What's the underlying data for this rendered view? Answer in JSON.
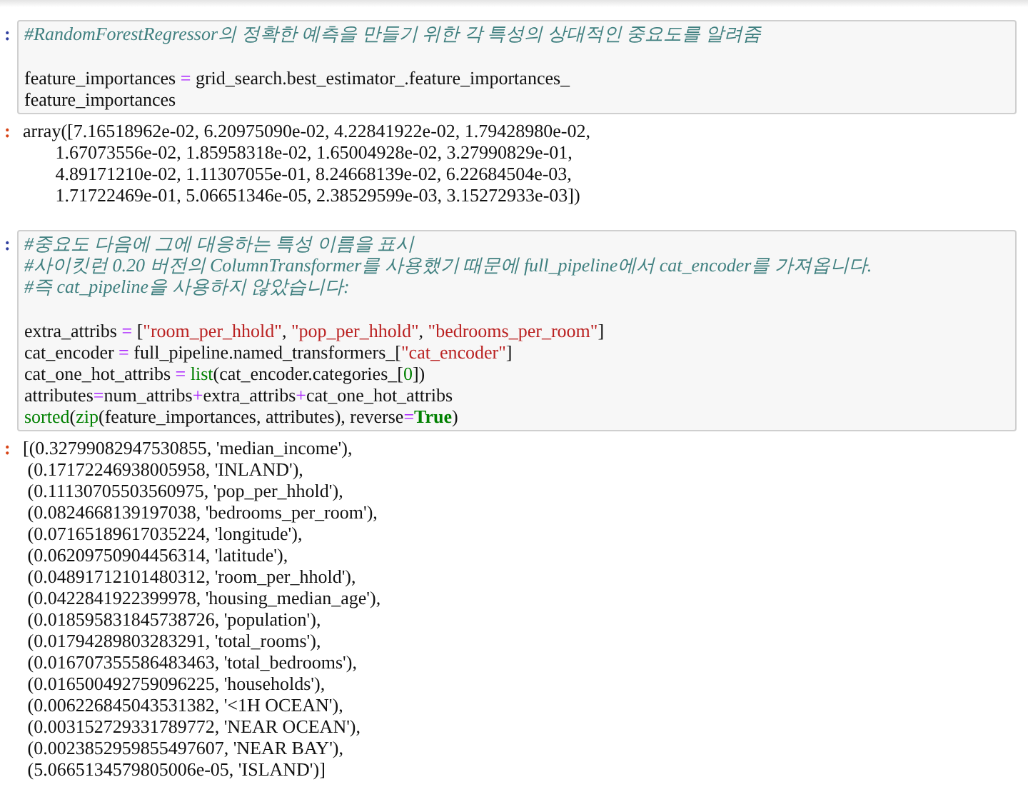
{
  "cells": [
    {
      "kind": "code",
      "prompt": ":",
      "blocks": [
        [
          [
            {
              "kind": "comment",
              "text": "#RandomForestRegressor의 정확한 예측을 만들기 위한 각 특성의 상대적인 중요도를 알려줌"
            }
          ]
        ],
        [
          [
            {
              "kind": "name",
              "text": "feature_importances "
            },
            {
              "kind": "op",
              "text": "="
            },
            {
              "kind": "name",
              "text": " grid_search.best_estimator_.feature_importances_"
            }
          ],
          [
            {
              "kind": "name",
              "text": "feature_importances"
            }
          ]
        ]
      ]
    },
    {
      "kind": "output",
      "prompt": ":",
      "lines": [
        "array([7.16518962e-02, 6.20975090e-02, 4.22841922e-02, 1.79428980e-02,",
        "       1.67073556e-02, 1.85958318e-02, 1.65004928e-02, 3.27990829e-01,",
        "       4.89171210e-02, 1.11307055e-01, 8.24668139e-02, 6.22684504e-03,",
        "       1.71722469e-01, 5.06651346e-05, 2.38529599e-03, 3.15272933e-03])"
      ]
    },
    {
      "kind": "code",
      "prompt": ":",
      "blocks": [
        [
          [
            {
              "kind": "comment",
              "text": "#중요도 다음에 그에 대응하는 특성 이름을 표시"
            }
          ],
          [
            {
              "kind": "comment",
              "text": "#사이킷런 0.20 버전의 ColumnTransformer를 사용했기 때문에 full_pipeline에서 cat_encoder를 가져옵니다."
            }
          ],
          [
            {
              "kind": "comment",
              "text": "#즉 cat_pipeline을 사용하지 않았습니다:"
            }
          ]
        ],
        [
          [
            {
              "kind": "name",
              "text": "extra_attribs "
            },
            {
              "kind": "op",
              "text": "="
            },
            {
              "kind": "name",
              "text": " ["
            },
            {
              "kind": "string",
              "text": "\"room_per_hhold\""
            },
            {
              "kind": "name",
              "text": ", "
            },
            {
              "kind": "string",
              "text": "\"pop_per_hhold\""
            },
            {
              "kind": "name",
              "text": ", "
            },
            {
              "kind": "string",
              "text": "\"bedrooms_per_room\""
            },
            {
              "kind": "name",
              "text": "]"
            }
          ],
          [
            {
              "kind": "name",
              "text": "cat_encoder "
            },
            {
              "kind": "op",
              "text": "="
            },
            {
              "kind": "name",
              "text": " full_pipeline.named_transformers_["
            },
            {
              "kind": "string",
              "text": "\"cat_encoder\""
            },
            {
              "kind": "name",
              "text": "]"
            }
          ],
          [
            {
              "kind": "name",
              "text": "cat_one_hot_attribs "
            },
            {
              "kind": "op",
              "text": "= "
            },
            {
              "kind": "builtin",
              "text": "list"
            },
            {
              "kind": "name",
              "text": "(cat_encoder.categories_["
            },
            {
              "kind": "number",
              "text": "0"
            },
            {
              "kind": "name",
              "text": "])"
            }
          ],
          [
            {
              "kind": "name",
              "text": "attributes"
            },
            {
              "kind": "op",
              "text": "="
            },
            {
              "kind": "name",
              "text": "num_attribs"
            },
            {
              "kind": "op",
              "text": "+"
            },
            {
              "kind": "name",
              "text": "extra_attribs"
            },
            {
              "kind": "op",
              "text": "+"
            },
            {
              "kind": "name",
              "text": "cat_one_hot_attribs"
            }
          ],
          [
            {
              "kind": "builtin",
              "text": "sorted"
            },
            {
              "kind": "name",
              "text": "("
            },
            {
              "kind": "builtin",
              "text": "zip"
            },
            {
              "kind": "name",
              "text": "(feature_importances, attributes), reverse"
            },
            {
              "kind": "op",
              "text": "="
            },
            {
              "kind": "keyword",
              "text": "True"
            },
            {
              "kind": "name",
              "text": ")"
            }
          ]
        ]
      ]
    },
    {
      "kind": "output",
      "prompt": ":",
      "lines": [
        "[(0.32799082947530855, 'median_income'),",
        " (0.17172246938005958, 'INLAND'),",
        " (0.11130705503560975, 'pop_per_hhold'),",
        " (0.0824668139197038, 'bedrooms_per_room'),",
        " (0.07165189617035224, 'longitude'),",
        " (0.06209750904456314, 'latitude'),",
        " (0.04891712101480312, 'room_per_hhold'),",
        " (0.0422841922399978, 'housing_median_age'),",
        " (0.018595831845738726, 'population'),",
        " (0.01794289803283291, 'total_rooms'),",
        " (0.016707355586483463, 'total_bedrooms'),",
        " (0.016500492759096225, 'households'),",
        " (0.006226845043531382, '<1H OCEAN'),",
        " (0.003152729331789772, 'NEAR OCEAN'),",
        " (0.0023852959855497607, 'NEAR BAY'),",
        " (5.0665134579805006e-05, 'ISLAND')]"
      ]
    }
  ]
}
